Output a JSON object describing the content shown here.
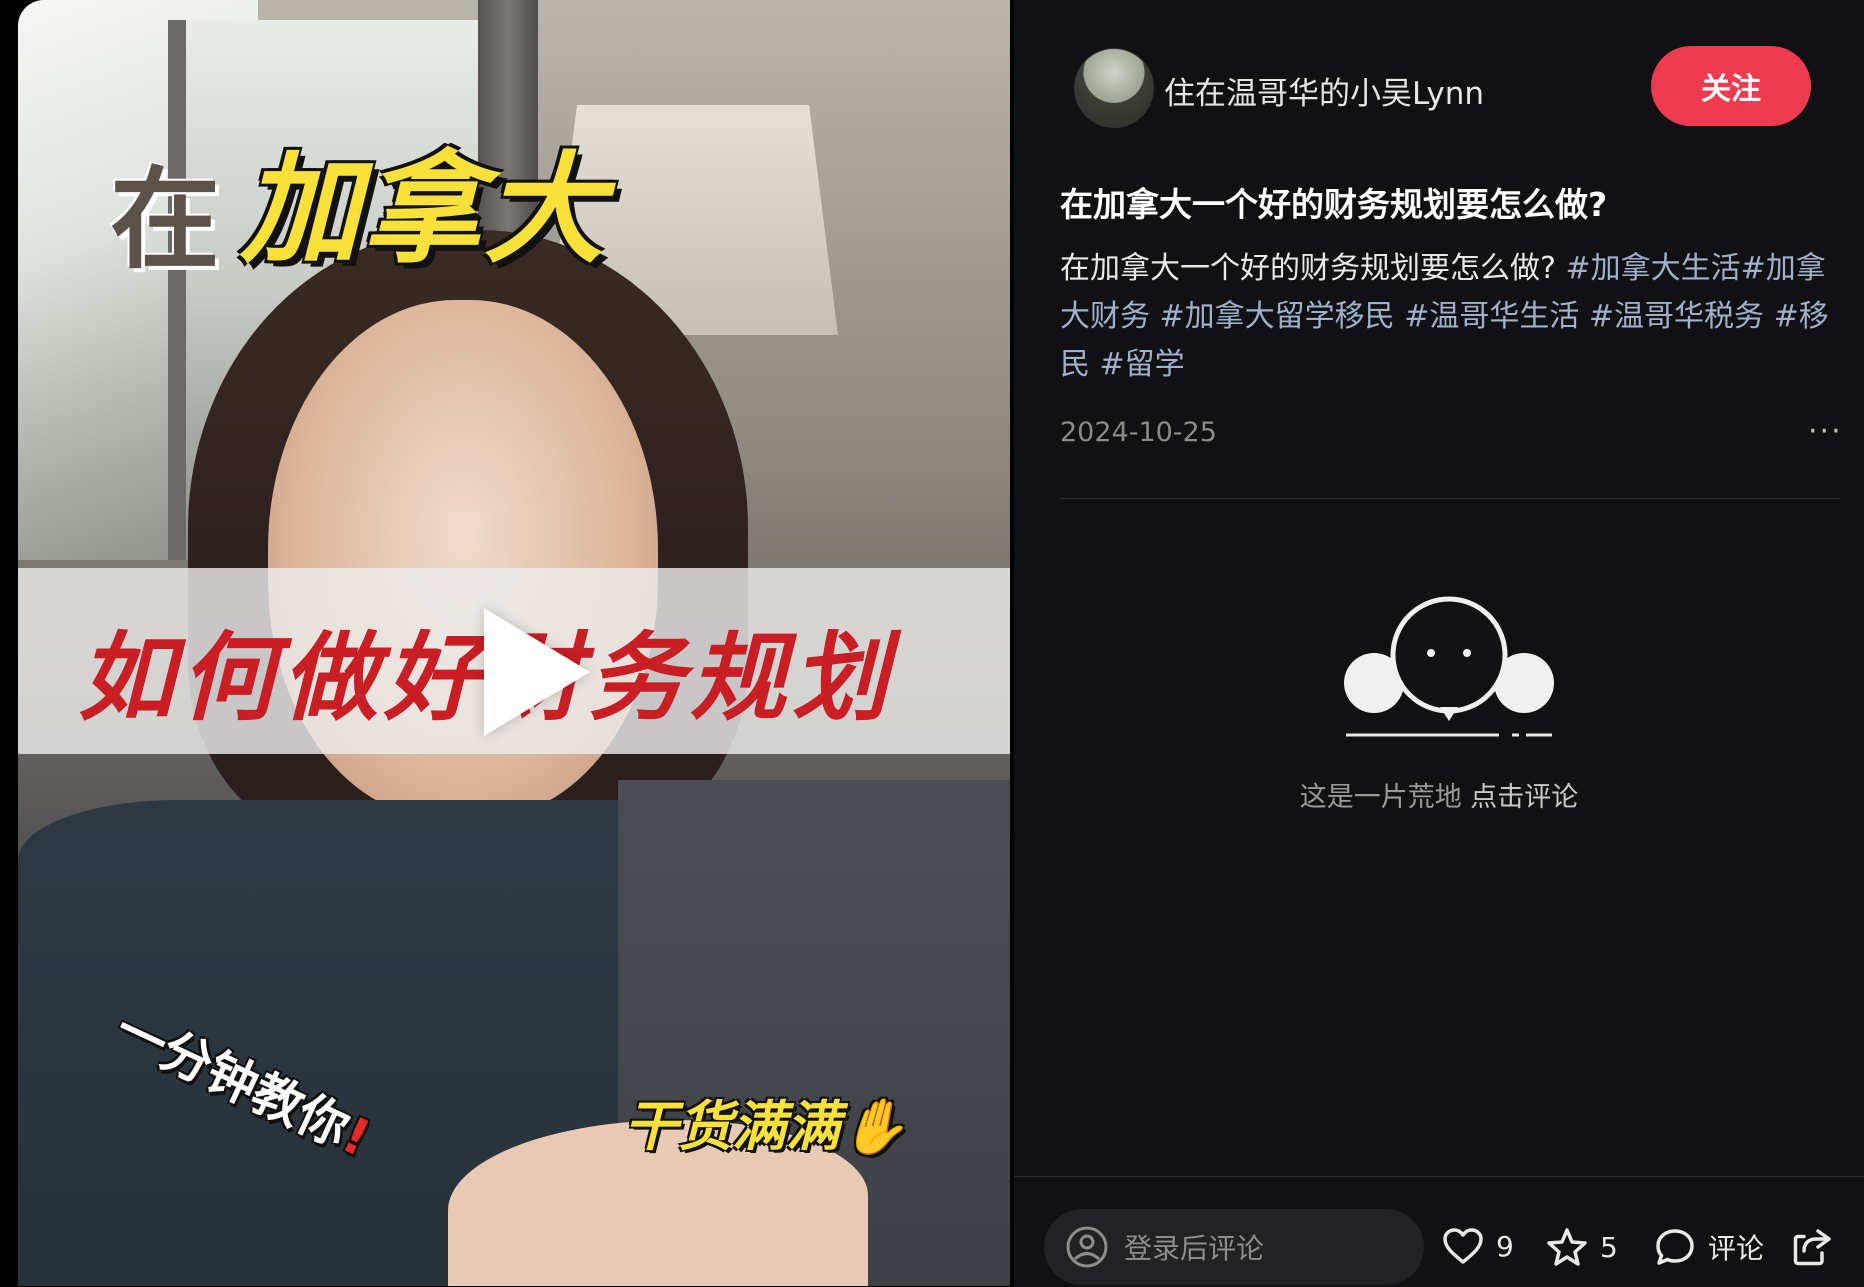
{
  "video": {
    "overlay_top_a": "在",
    "overlay_top_b": "加拿大",
    "overlay_middle": "如何做好财务规划",
    "overlay_bottom_left": "一分钟教你",
    "overlay_bottom_left_mark": "!",
    "overlay_bottom_right": "干货满满✋"
  },
  "author": {
    "name": "住在温哥华的小吴Lynn",
    "follow_label": "关注"
  },
  "post": {
    "title": "在加拿大一个好的财务规划要怎么做?",
    "desc_text": "在加拿大一个好的财务规划要怎么做?",
    "tags": [
      "#加拿大生活",
      "#加拿大财务",
      "#加拿大留学移民",
      "#温哥华生活",
      "#温哥华税务",
      "#移民",
      "#留学"
    ],
    "date": "2024-10-25",
    "more_label": "···"
  },
  "comments": {
    "empty_text": "这是一片荒地",
    "empty_link": "点击评论"
  },
  "bottom_bar": {
    "input_placeholder": "登录后评论",
    "likes": "9",
    "favorites": "5",
    "comment_label": "评论"
  }
}
